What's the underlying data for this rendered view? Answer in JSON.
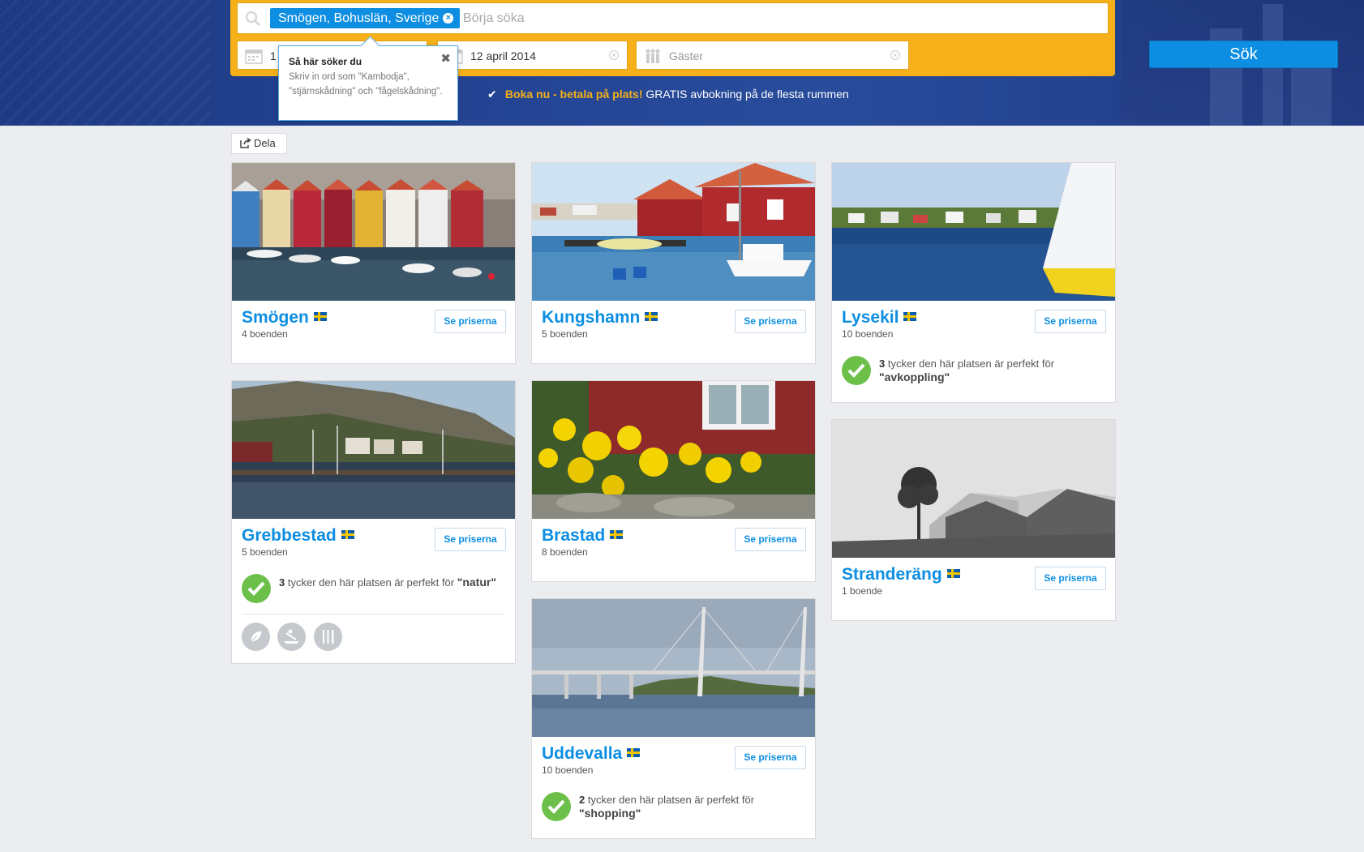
{
  "search": {
    "chip": "Smögen, Bohuslän, Sverige",
    "placeholder": "Börja söka",
    "checkin_value": "1",
    "checkout_value": "12 april 2014",
    "guests_placeholder": "Gäster",
    "button": "Sök"
  },
  "promo": {
    "highlight": "Boka nu - betala på plats!",
    "text": "GRATIS avbokning på de flesta rummen"
  },
  "tooltip": {
    "title": "Så här söker du",
    "body": "Skriv in ord som \"Kambodja\", \"stjärnskådning\" och \"fågelskådning\"."
  },
  "share": {
    "label": "Dela"
  },
  "price_label": "Se priserna",
  "destinations": [
    {
      "name": "Smögen",
      "count": "4 boenden"
    },
    {
      "name": "Kungshamn",
      "count": "5 boenden"
    },
    {
      "name": "Lysekil",
      "count": "10 boenden",
      "reco_count": "3",
      "reco_text": "tycker den här platsen är perfekt för",
      "reco_tag": "\"avkoppling\""
    },
    {
      "name": "Grebbestad",
      "count": "5 boenden",
      "reco_count": "3",
      "reco_text": "tycker den här platsen är perfekt för",
      "reco_tag": "\"natur\""
    },
    {
      "name": "Brastad",
      "count": "8 boenden"
    },
    {
      "name": "Stranderäng",
      "count": "1 boende"
    },
    {
      "name": "Uddevalla",
      "count": "10 boenden",
      "reco_count": "2",
      "reco_text": "tycker den här platsen är perfekt för",
      "reco_tag": "\"shopping\""
    }
  ],
  "colors": {
    "accent": "#0d8ee2",
    "panel": "#f5b01a",
    "hero": "#244493",
    "ok": "#6cc04a"
  }
}
